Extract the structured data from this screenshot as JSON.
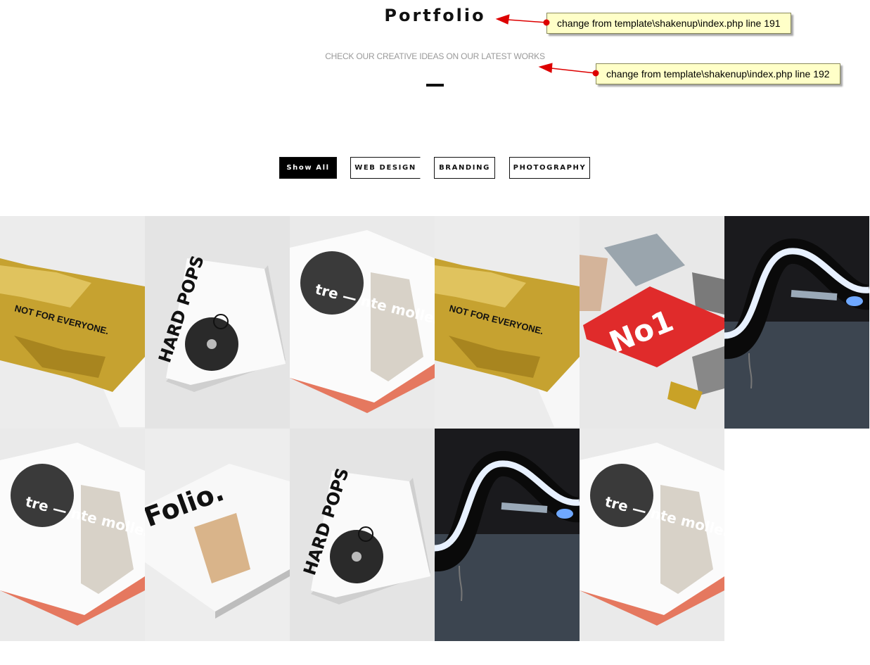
{
  "header": {
    "title": "Portfolio",
    "subtitle": "CHECK OUR CREATIVE IDEAS ON OUR LATEST WORKS"
  },
  "annotations": [
    {
      "text": "change from template\\shakenup\\index.php line 191"
    },
    {
      "text": "change from template\\shakenup\\index.php line 192"
    }
  ],
  "filters": [
    {
      "label": "Show All",
      "active": true
    },
    {
      "label": "WEB DESIGN",
      "active": false
    },
    {
      "label": "BRANDING",
      "active": false
    },
    {
      "label": "PHOTOGRAPHY",
      "active": false
    }
  ],
  "portfolio": {
    "row1": [
      {
        "image": "gold-pouch",
        "text": "NOT FOR EVERYONE."
      },
      {
        "image": "hard-pops-cd",
        "text": "HARD POPS"
      },
      {
        "image": "tre-nte-moller-book",
        "text": "tre — nte moller"
      },
      {
        "image": "gold-pouch",
        "text": "NOT FOR EVERYONE."
      },
      {
        "image": "no1-magazine",
        "text": "No1"
      },
      {
        "image": "neon-tube",
        "text": ""
      }
    ],
    "row2": [
      {
        "image": "tre-nte-moller-book",
        "text": "tre — nte moller"
      },
      {
        "image": "folio-magazine",
        "text": "Folio."
      },
      {
        "image": "hard-pops-cd",
        "text": "HARD POPS"
      },
      {
        "image": "neon-tube",
        "text": ""
      },
      {
        "image": "tre-nte-moller-book",
        "text": "tre — nte moller"
      }
    ]
  },
  "colors": {
    "accent": "#000000",
    "annotation_bg": "#ffffc8",
    "arrow": "#dd0000",
    "gold": "#c9a227",
    "red": "#e02b2b"
  }
}
